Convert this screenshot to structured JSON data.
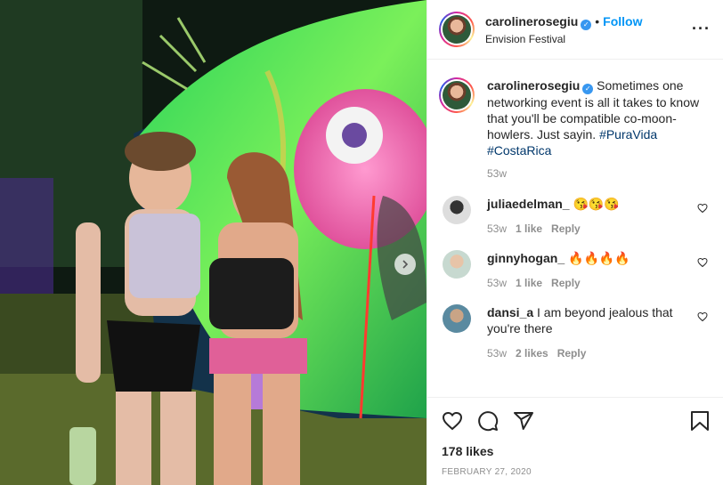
{
  "post": {
    "username": "carolinerosegiu",
    "follow_label": "Follow",
    "location": "Envision Festival",
    "caption_text": "Sometimes one networking event is all it takes to know that you'll be compatible co-moon-howlers. Just sayin.",
    "hashtags": [
      "#PuraVida",
      "#CostaRica"
    ],
    "caption_time": "53w",
    "likes": "178 likes",
    "date": "FEBRUARY 27, 2020"
  },
  "comments": [
    {
      "username": "juliaedelman_",
      "text": "😘😘😘",
      "time": "53w",
      "likes": "1 like",
      "reply": "Reply"
    },
    {
      "username": "ginnyhogan_",
      "text": "🔥🔥🔥🔥",
      "time": "53w",
      "likes": "1 like",
      "reply": "Reply"
    },
    {
      "username": "dansi_a",
      "text": "I am beyond jealous that you're there",
      "time": "53w",
      "likes": "2 likes",
      "reply": "Reply"
    }
  ],
  "colors": {
    "follow": "#0095f6",
    "verified": "#3897f0",
    "hashtag": "#00376b",
    "muted": "#8e8e8e"
  },
  "icons": {
    "more": "more-options-icon",
    "verified": "verified-badge-icon",
    "heart": "heart-icon",
    "comment": "comment-icon",
    "share": "share-icon",
    "save": "bookmark-icon",
    "carousel_next": "chevron-right-icon"
  }
}
